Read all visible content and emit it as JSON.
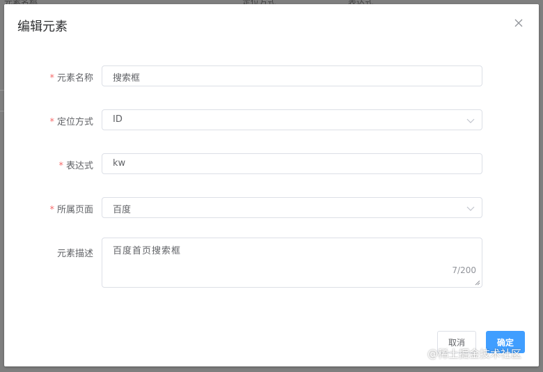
{
  "background": {
    "header_cols": [
      "元素名称",
      "定位方式",
      "表达式"
    ]
  },
  "dialog": {
    "title": "编辑元素",
    "close_icon": "close-icon"
  },
  "form": {
    "required_mark": "*",
    "fields": [
      {
        "label": "元素名称",
        "value": "搜索框",
        "required": true,
        "type": "text"
      },
      {
        "label": "定位方式",
        "value": "ID",
        "required": true,
        "type": "select"
      },
      {
        "label": "表达式",
        "value": "kw",
        "required": true,
        "type": "text"
      },
      {
        "label": "所属页面",
        "value": "百度",
        "required": true,
        "type": "select"
      },
      {
        "label": "元素描述",
        "value": "百度首页搜索框",
        "required": false,
        "type": "textarea",
        "counter": "7/200"
      }
    ]
  },
  "footer": {
    "cancel_label": "取消",
    "confirm_label": "确定"
  },
  "watermark": "@稀土掘金技术社区",
  "colors": {
    "required": "#f56c6c",
    "primary": "#409eff"
  }
}
